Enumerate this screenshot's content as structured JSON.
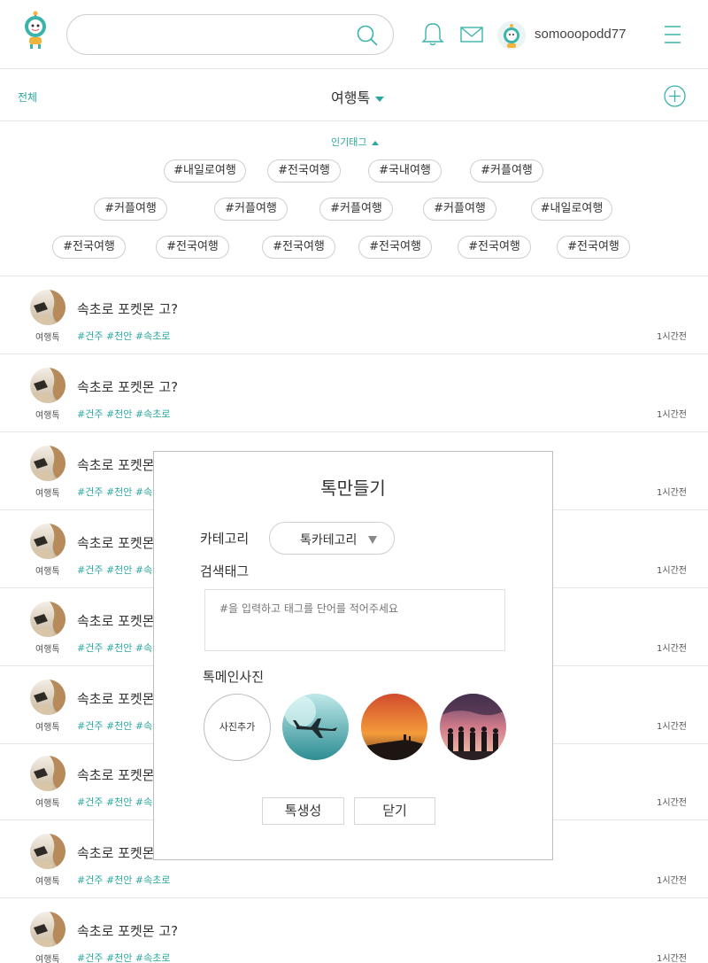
{
  "header": {
    "search_placeholder": "",
    "username": "somooopodd77"
  },
  "subheader": {
    "all_label": "전체",
    "category_label": "여행톡"
  },
  "tags": {
    "title": "인기태그",
    "rows": [
      [
        "#내일로여행",
        "#전국여행",
        "#국내여행",
        "#커플여행"
      ],
      [
        "#커플여행",
        "#커플여행",
        "#커플여행",
        "#커플여행",
        "#내일로여행"
      ],
      [
        "#전국여행",
        "#전국여행",
        "#전국여행",
        "#전국여행",
        "#전국여행",
        "#전국여행"
      ]
    ]
  },
  "posts": [
    {
      "title": "속초로 포켓몬 고?",
      "category": "여행톡",
      "tags": "#건주 #천안 #속초로",
      "time": "1시간전"
    },
    {
      "title": "속초로 포켓몬 고?",
      "category": "여행톡",
      "tags": "#건주 #천안 #속초로",
      "time": "1시간전"
    },
    {
      "title": "속초로 포켓몬 고?",
      "category": "여행톡",
      "tags": "#건주 #천안 #속초로",
      "time": "1시간전"
    },
    {
      "title": "속초로 포켓몬 고?",
      "category": "여행톡",
      "tags": "#건주 #천안 #속초로",
      "time": "1시간전"
    },
    {
      "title": "속초로 포켓몬 고?",
      "category": "여행톡",
      "tags": "#건주 #천안 #속초로",
      "time": "1시간전"
    },
    {
      "title": "속초로 포켓몬 고?",
      "category": "여행톡",
      "tags": "#건주 #천안 #속초로",
      "time": "1시간전"
    },
    {
      "title": "속초로 포켓몬 고?",
      "category": "여행톡",
      "tags": "#건주 #천안 #속초로",
      "time": "1시간전"
    },
    {
      "title": "속초로 포켓몬 고?",
      "category": "여행톡",
      "tags": "#건주 #천안 #속초로",
      "time": "1시간전"
    },
    {
      "title": "속초로 포켓몬 고?",
      "category": "여행톡",
      "tags": "#건주 #천안 #속초로",
      "time": "1시간전"
    }
  ],
  "modal": {
    "title": "톡만들기",
    "category_label": "카테고리",
    "category_select": "톡카테고리",
    "tag_label": "검색태그",
    "tag_placeholder": "#을 입력하고 태그를 단어를 적어주세요",
    "photo_label": "톡메인사진",
    "photo_add": "사진추가",
    "create_button": "톡생성",
    "close_button": "닫기"
  },
  "colors": {
    "accent": "#2aa8a0",
    "border": "#e6e6e6"
  },
  "icons": [
    "logo-mascot-icon",
    "search-icon",
    "bell-icon",
    "mail-icon",
    "menu-icon",
    "add-circle-icon",
    "caret-down-icon",
    "caret-up-icon"
  ]
}
